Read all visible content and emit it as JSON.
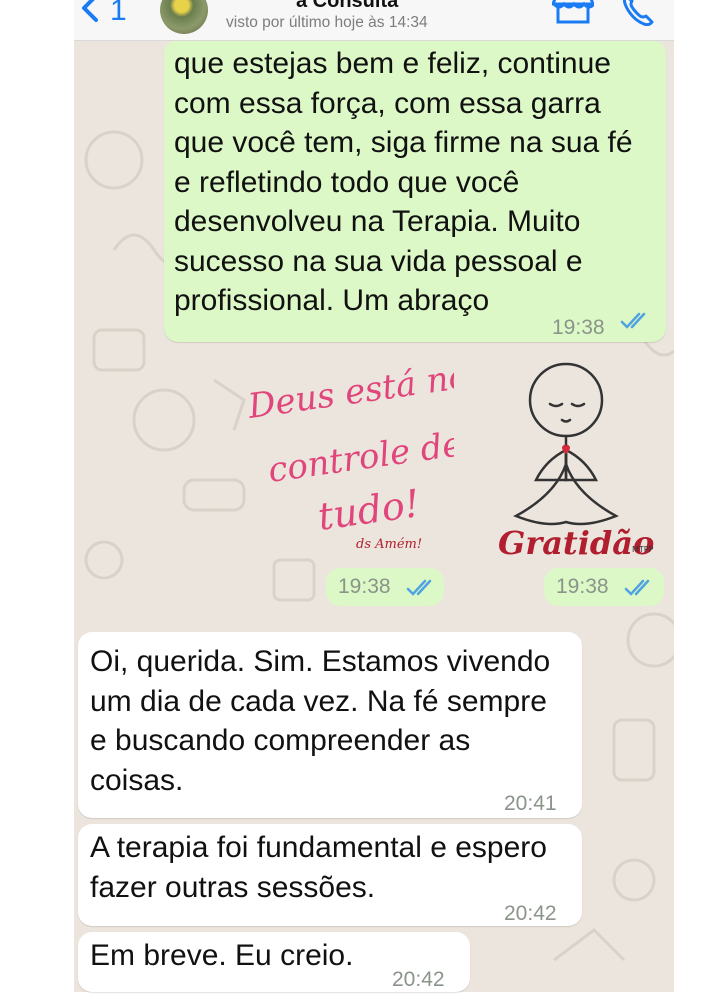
{
  "header": {
    "back_count": "1",
    "contact_name": "a Consulta",
    "last_seen": "visto por último hoje às 14:34"
  },
  "messages": [
    {
      "direction": "outgoing",
      "text": "que estejas bem e feliz, continue\ncom essa força, com essa garra\nque você tem, siga firme na sua fé\ne refletindo todo que você\ndesenvolveu na Terapia. Muito\nsucesso na sua vida pessoal e\nprofissional. Um abraço",
      "time": "19:38",
      "status": "read"
    },
    {
      "direction": "outgoing",
      "type": "sticker",
      "sticker_text": [
        "Deus está no",
        "controle de",
        "tudo!"
      ],
      "sticker_signature": "ds Amém!",
      "time": "19:38",
      "status": "read"
    },
    {
      "direction": "outgoing",
      "type": "sticker",
      "sticker_text": [
        "Gratidão"
      ],
      "sticker_signature": "MTPP",
      "time": "19:38",
      "status": "read"
    },
    {
      "direction": "incoming",
      "text": "Oi, querida. Sim. Estamos vivendo\num dia de cada vez. Na fé sempre\ne buscando compreender as\ncoisas.",
      "time": "20:41"
    },
    {
      "direction": "incoming",
      "text": "A terapia foi fundamental e espero\nfazer outras sessões.",
      "time": "20:42"
    },
    {
      "direction": "incoming",
      "text": "Em breve. Eu creio.",
      "time": "20:42"
    }
  ],
  "colors": {
    "outgoing_bubble": "#dcf8c6",
    "incoming_bubble": "#ffffff",
    "chat_background": "#ece5dd",
    "read_ticks": "#4fa3e0",
    "ios_blue": "#1a7cf5",
    "sticker_pink": "#e0457b",
    "sticker_red": "#b01e2f"
  },
  "icons": {
    "back": "chevron-left-icon",
    "shop": "storefront-icon",
    "call": "phone-icon",
    "read_receipt": "double-check-icon"
  }
}
